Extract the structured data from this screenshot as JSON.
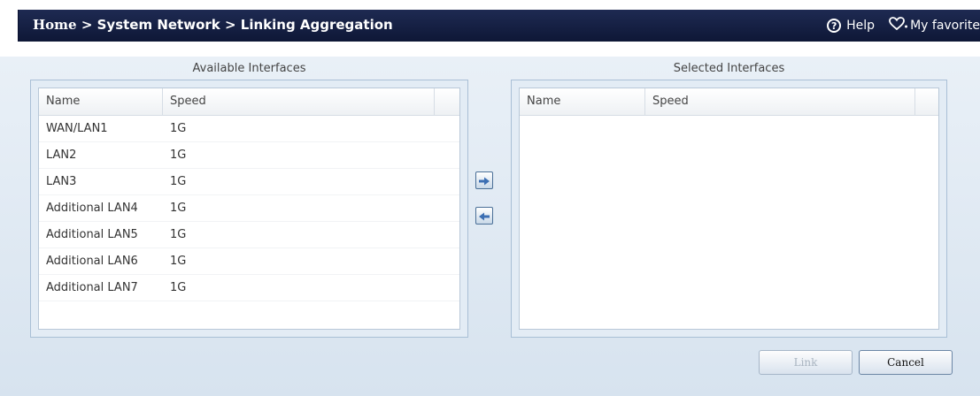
{
  "header": {
    "breadcrumb": {
      "home": "Home",
      "sep1": " > ",
      "section": "System Network",
      "sep2": " > ",
      "page": "Linking Aggregation"
    },
    "help_label": "Help",
    "favorite_label": "My favorite",
    "help_icon": "question-circle-icon",
    "favorite_icon": "heart-plus-icon"
  },
  "available": {
    "caption": "Available Interfaces",
    "columns": [
      "Name",
      "Speed"
    ],
    "rows": [
      {
        "name": "WAN/LAN1",
        "speed": "1G"
      },
      {
        "name": "LAN2",
        "speed": "1G"
      },
      {
        "name": "LAN3",
        "speed": "1G"
      },
      {
        "name": "Additional LAN4",
        "speed": "1G"
      },
      {
        "name": "Additional LAN5",
        "speed": "1G"
      },
      {
        "name": "Additional LAN6",
        "speed": "1G"
      },
      {
        "name": "Additional LAN7",
        "speed": "1G"
      }
    ]
  },
  "selected": {
    "caption": "Selected Interfaces",
    "columns": [
      "Name",
      "Speed"
    ],
    "rows": []
  },
  "transfer": {
    "add_icon": "arrow-right-icon",
    "remove_icon": "arrow-left-icon"
  },
  "actions": {
    "link_label": "Link",
    "cancel_label": "Cancel"
  },
  "colors": {
    "title_bar": "#15204a",
    "arrow": "#3c6fb3"
  }
}
